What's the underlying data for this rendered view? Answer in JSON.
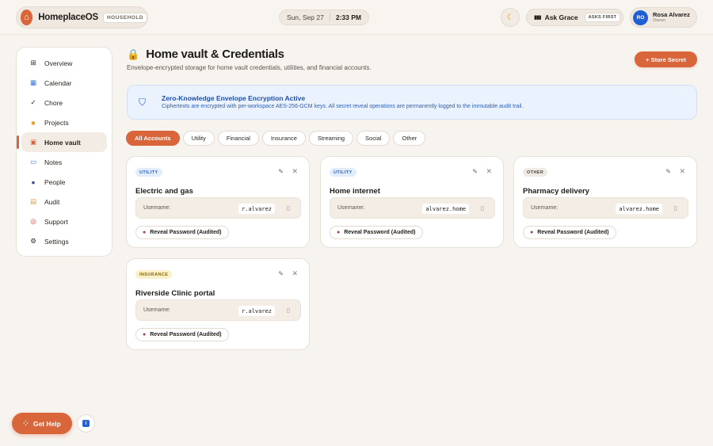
{
  "header": {
    "brand_name": "HomeplaceOS",
    "brand_tag": "HOUSEHOLD",
    "date": "Sun, Sep 27",
    "time": "2:33 PM",
    "ask_label": "Ask Grace",
    "ask_badge": "ASKS FIRST",
    "user_initials": "RO",
    "user_name": "Rosa Alvarez",
    "user_role": "Owner"
  },
  "sidebar": {
    "items": [
      {
        "label": "Overview",
        "icon": "grid-icon"
      },
      {
        "label": "Calendar",
        "icon": "calendar-icon"
      },
      {
        "label": "Chore",
        "icon": "check-icon"
      },
      {
        "label": "Projects",
        "icon": "folder-icon"
      },
      {
        "label": "Home vault",
        "icon": "lock-icon",
        "active": true
      },
      {
        "label": "Notes",
        "icon": "book-icon"
      },
      {
        "label": "People",
        "icon": "people-icon"
      },
      {
        "label": "Audit",
        "icon": "scroll-icon"
      },
      {
        "label": "Support",
        "icon": "lifebuoy-icon"
      },
      {
        "label": "Settings",
        "icon": "gear-icon"
      }
    ]
  },
  "main": {
    "title": "Home vault & Credentials",
    "subtitle": "Envelope-encrypted storage for home vault credentials, utilities, and financial accounts.",
    "store_button": "+ Store Secret",
    "banner": {
      "title": "Zero-Knowledge Envelope Encryption Active",
      "text": "Ciphertexts are encrypted with per-workspace AES-256-GCM keys. All secret reveal operations are permanently logged to the immutable audit trail."
    },
    "filters": [
      "All Accounts",
      "Utility",
      "Financial",
      "Insurance",
      "Streaming",
      "Social",
      "Other"
    ],
    "active_filter": "All Accounts",
    "cards": [
      {
        "tag": "UTILITY",
        "name": "Electric and gas",
        "username_label": "Username:",
        "username": "r.alvarez",
        "reveal": "Reveal Password (Audited)"
      },
      {
        "tag": "UTILITY",
        "name": "Home internet",
        "username_label": "Username:",
        "username": "alvarez.home",
        "reveal": "Reveal Password (Audited)"
      },
      {
        "tag": "OTHER",
        "name": "Pharmacy delivery",
        "username_label": "Username:",
        "username": "alvarez.home",
        "reveal": "Reveal Password (Audited)"
      },
      {
        "tag": "INSURANCE",
        "name": "Riverside Clinic portal",
        "username_label": "Username:",
        "username": "r.alvarez",
        "reveal": "Reveal Password (Audited)"
      }
    ]
  },
  "help_button": "Get Help",
  "colors": {
    "accent": "#d9653b",
    "info": "#2563d8",
    "background": "#f7f4f0"
  }
}
